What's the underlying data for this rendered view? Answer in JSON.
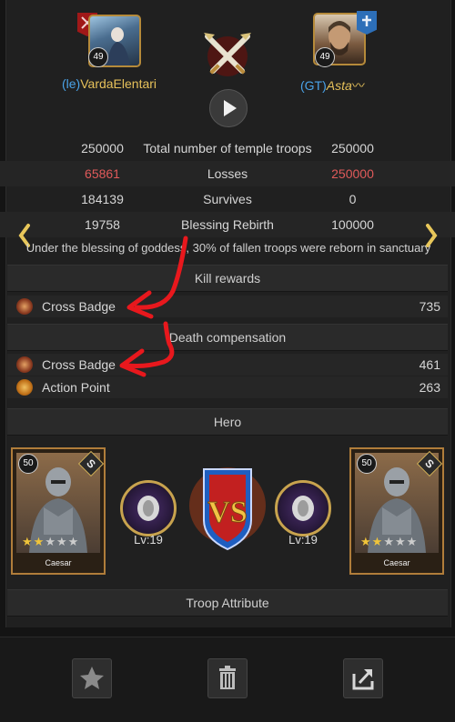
{
  "players": {
    "left": {
      "tag": "(le)",
      "name": "VardaElentari",
      "level": "49"
    },
    "right": {
      "tag": "(GT)",
      "name": "Asta",
      "level": "49"
    }
  },
  "stats": [
    {
      "left": "250000",
      "label": "Total number of temple troops",
      "right": "250000"
    },
    {
      "left": "65861",
      "label": "Losses",
      "right": "250000"
    },
    {
      "left": "184139",
      "label": "Survives",
      "right": "0"
    },
    {
      "left": "19758",
      "label": "Blessing Rebirth",
      "right": "100000"
    }
  ],
  "blessing_note": "Under the blessing of goddess, 30% of fallen troops were reborn in sanctuary",
  "sections": {
    "kill_rewards": "Kill rewards",
    "death_compensation": "Death compensation",
    "hero": "Hero",
    "troop_attribute": "Troop Attribute"
  },
  "kill_rewards": [
    {
      "name": "Cross Badge",
      "value": "735",
      "icon": "cross-badge-icon"
    }
  ],
  "death_compensation": [
    {
      "name": "Cross Badge",
      "value": "461",
      "icon": "cross-badge-icon"
    },
    {
      "name": "Action Point",
      "value": "263",
      "icon": "action-point-icon"
    }
  ],
  "heroes": {
    "left": {
      "name": "Caesar",
      "level": "50",
      "rank": "S",
      "stars": 2
    },
    "right": {
      "name": "Caesar",
      "level": "50",
      "rank": "S",
      "stars": 2
    }
  },
  "gear": {
    "left_level": "Lv:19",
    "right_level": "Lv:19"
  },
  "vs_label": "VS",
  "colors": {
    "accent_blue": "#4aa3e8",
    "loss_red": "#e05a5a",
    "gold": "#d9a640",
    "annotation_red": "#e8181d"
  },
  "toolbar": {
    "icons": [
      "star-icon",
      "trash-icon",
      "share-icon"
    ]
  }
}
